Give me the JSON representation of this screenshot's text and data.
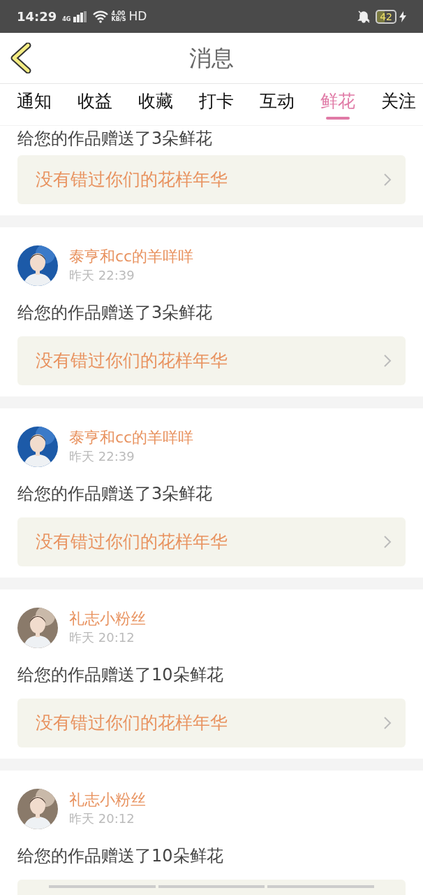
{
  "status_bar": {
    "time": "14:29",
    "network": "4G",
    "speed": "4.00",
    "speed_unit": "KB/S",
    "hd": "HD",
    "battery": "42"
  },
  "header": {
    "title": "消息"
  },
  "tabs": [
    {
      "label": "通知",
      "selected": false
    },
    {
      "label": "收益",
      "selected": false
    },
    {
      "label": "收藏",
      "selected": false
    },
    {
      "label": "打卡",
      "selected": false
    },
    {
      "label": "互动",
      "selected": false
    },
    {
      "label": "鲜花",
      "selected": true
    },
    {
      "label": "关注",
      "selected": false
    }
  ],
  "messages": [
    {
      "partial": true,
      "text": "给您的作品赠送了3朵鲜花",
      "link": "没有错过你们的花样年华"
    },
    {
      "user": "泰亨和cc的羊咩咩",
      "time": "昨天 22:39",
      "text": "给您的作品赠送了3朵鲜花",
      "link": "没有错过你们的花样年华"
    },
    {
      "user": "泰亨和cc的羊咩咩",
      "time": "昨天 22:39",
      "text": "给您的作品赠送了3朵鲜花",
      "link": "没有错过你们的花样年华"
    },
    {
      "user": "礼志小粉丝",
      "time": "昨天 20:12",
      "text": "给您的作品赠送了10朵鲜花",
      "link": "没有错过你们的花样年华"
    },
    {
      "user": "礼志小粉丝",
      "time": "昨天 20:12",
      "text": "给您的作品赠送了10朵鲜花",
      "loading": true
    }
  ]
}
